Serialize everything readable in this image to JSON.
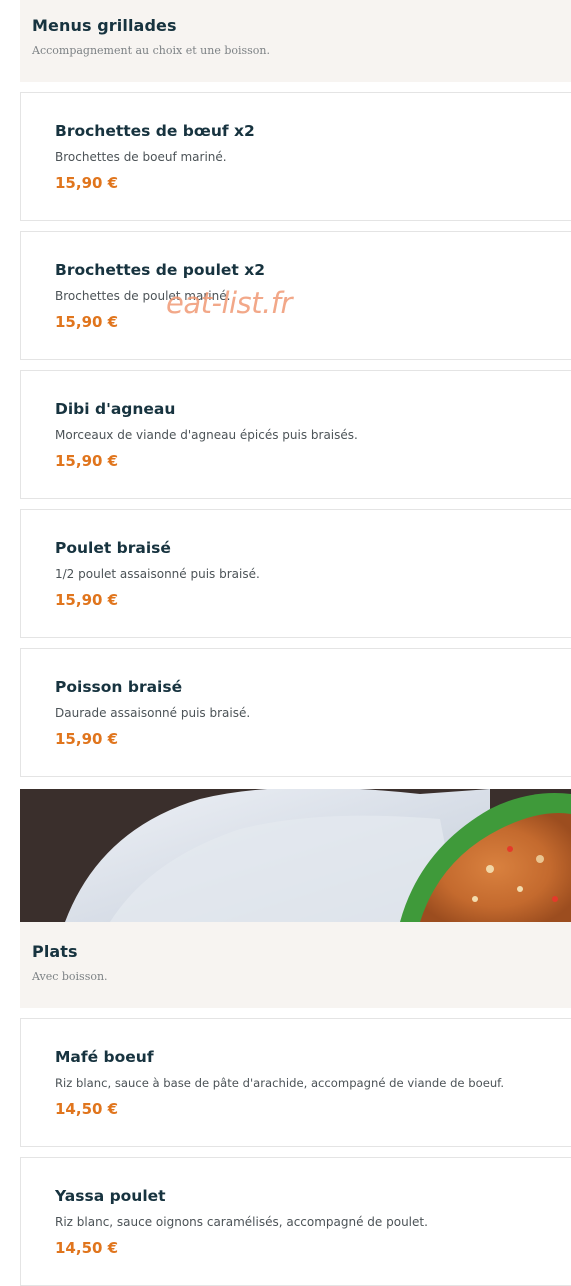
{
  "sections": [
    {
      "title": "Menus grillades",
      "subtitle": "Accompagnement au choix et une boisson.",
      "items": [
        {
          "name": "Brochettes de bœuf x2",
          "description": "Brochettes de boeuf mariné.",
          "price": "15,90 €"
        },
        {
          "name": "Brochettes de poulet x2",
          "description": "Brochettes de poulet mariné.",
          "price": "15,90 €"
        },
        {
          "name": "Dibi d'agneau",
          "description": "Morceaux de viande d'agneau épicés puis braisés.",
          "price": "15,90 €"
        },
        {
          "name": "Poulet braisé",
          "description": "1/2 poulet assaisonné puis braisé.",
          "price": "15,90 €"
        },
        {
          "name": "Poisson braisé",
          "description": "Daurade assaisonné puis braisé.",
          "price": "15,90 €"
        }
      ]
    },
    {
      "title": "Plats",
      "subtitle": "Avec boisson.",
      "items": [
        {
          "name": "Mafé boeuf",
          "description": "Riz blanc, sauce à base de pâte d'arachide, accompagné de viande de boeuf.",
          "price": "14,50 €"
        },
        {
          "name": "Yassa poulet",
          "description": "Riz blanc, sauce oignons caramélisés, accompagné de poulet.",
          "price": "14,50 €"
        }
      ]
    }
  ],
  "watermark": "eat-list.fr",
  "colors": {
    "title": "#17333f",
    "price": "#e0751d",
    "header_bg": "#f7f4f1",
    "watermark": "#f09a75"
  }
}
